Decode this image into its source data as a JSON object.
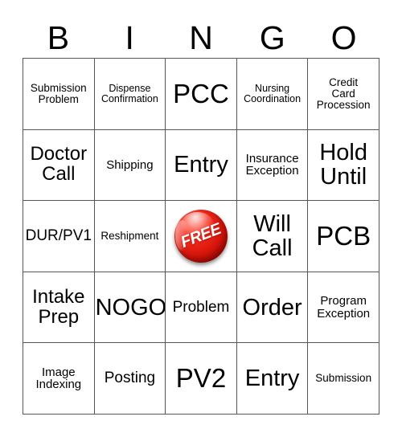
{
  "card": {
    "header_letters": [
      "B",
      "I",
      "N",
      "G",
      "O"
    ],
    "free_space": {
      "label": "FREE",
      "badge_color": "#e01a0d",
      "text_color": "#ffffff"
    },
    "colors": {
      "text": "#000000",
      "grid_line": "#555555",
      "background": "#ffffff"
    },
    "rows": [
      {
        "cells": [
          {
            "text": "Submission\nProblem",
            "is_free": false
          },
          {
            "text": "Dispense\nConfirmation",
            "is_free": false
          },
          {
            "text": "PCC",
            "is_free": false
          },
          {
            "text": "Nursing\nCoordination",
            "is_free": false
          },
          {
            "text": "Credit\nCard\nProcession",
            "is_free": false
          }
        ]
      },
      {
        "cells": [
          {
            "text": "Doctor\nCall",
            "is_free": false
          },
          {
            "text": "Shipping",
            "is_free": false
          },
          {
            "text": "Entry",
            "is_free": false
          },
          {
            "text": "Insurance\nException",
            "is_free": false
          },
          {
            "text": "Hold\nUntil",
            "is_free": false
          }
        ]
      },
      {
        "cells": [
          {
            "text": "DUR/PV1",
            "is_free": false
          },
          {
            "text": "Reshipment",
            "is_free": false
          },
          {
            "text": "FREE",
            "is_free": true
          },
          {
            "text": "Will\nCall",
            "is_free": false
          },
          {
            "text": "PCB",
            "is_free": false
          }
        ]
      },
      {
        "cells": [
          {
            "text": "Intake\nPrep",
            "is_free": false
          },
          {
            "text": "NOGO",
            "is_free": false
          },
          {
            "text": "Problem",
            "is_free": false
          },
          {
            "text": "Order",
            "is_free": false
          },
          {
            "text": "Program\nException",
            "is_free": false
          }
        ]
      },
      {
        "cells": [
          {
            "text": "Image\nIndexing",
            "is_free": false
          },
          {
            "text": "Posting",
            "is_free": false
          },
          {
            "text": "PV2",
            "is_free": false
          },
          {
            "text": "Entry",
            "is_free": false
          },
          {
            "text": "Submission",
            "is_free": false
          }
        ]
      }
    ]
  }
}
